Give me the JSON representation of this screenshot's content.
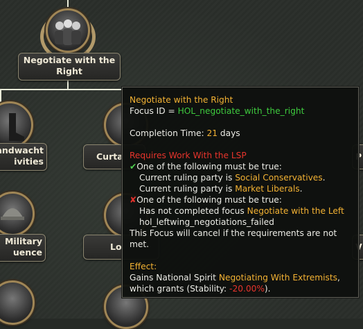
{
  "focus_tree": {
    "selected_focus": {
      "title_line1": "Negotiate with the",
      "title_line2": "Right"
    },
    "left_focus_1": {
      "title_line1": "andwacht",
      "title_line2": "ivities"
    },
    "left_focus_2": {
      "title_line1": "Curta"
    },
    "left_focus_3": {
      "title_line1": "Military",
      "title_line2": "uence"
    },
    "left_focus_4": {
      "title_line1": "Lo"
    },
    "right_edge_1": "P",
    "right_edge_2": "V"
  },
  "tooltip": {
    "title": "Negotiate with the Right",
    "focus_id_label": "Focus ID = ",
    "focus_id": "HOL_negotiate_with_the_right",
    "completion_label": "Completion Time: ",
    "completion_days": "21",
    "completion_unit": " days",
    "requires": "Requires Work With the LSP",
    "group1": {
      "header": "One of the following must be true:",
      "line1_prefix": "Current ruling party is ",
      "line1_value": "Social Conservatives",
      "line1_suffix": ".",
      "line2_prefix": "Current ruling party is ",
      "line2_value": "Market Liberals",
      "line2_suffix": "."
    },
    "group2": {
      "header": "One of the following must be true:",
      "line1_prefix": "Has not completed focus ",
      "line1_value": "Negotiate with the Left",
      "line2": "hol_leftwing_negotiations_failed"
    },
    "cancel_line1": "This Focus will cancel if the requirements are not",
    "cancel_line2": "met.",
    "effect_label": "Effect:",
    "effect_prefix": "Gains National Spirit ",
    "effect_value": "Negotiating With Extremists",
    "effect_suffix": ",",
    "grants_prefix": "which grants (Stability: ",
    "grants_value": "-20.00%",
    "grants_suffix": ")."
  },
  "colors": {
    "title_gold": "#f3b233",
    "id_green": "#3ecb3e",
    "requires_red": "#e8342c"
  }
}
